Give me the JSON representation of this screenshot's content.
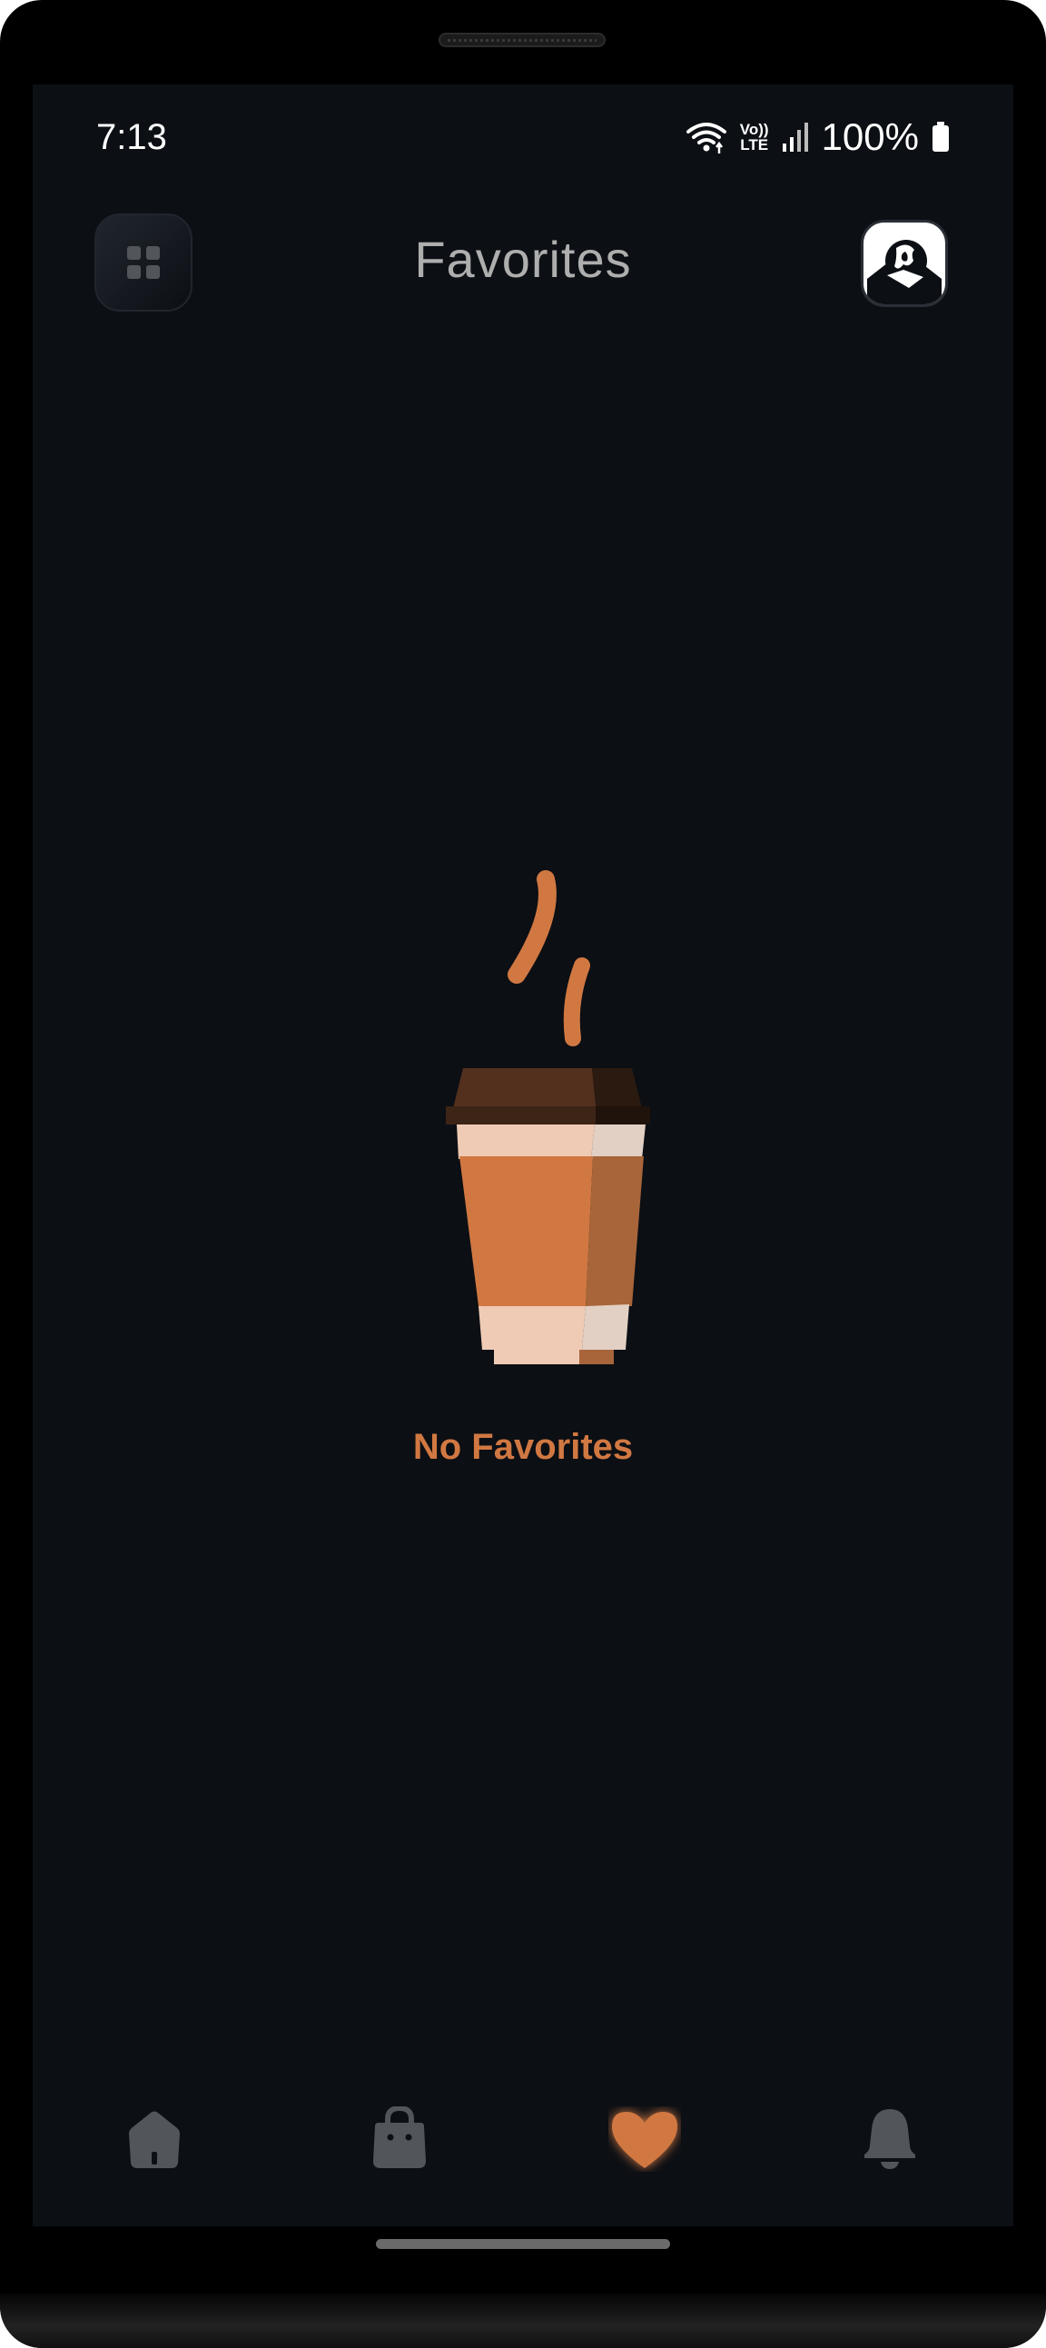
{
  "status_bar": {
    "time": "7:13",
    "network_label_top": "Vo))",
    "network_label_bottom": "LTE",
    "battery": "100%",
    "icons": [
      "wifi-icon",
      "signal-icon",
      "battery-icon"
    ]
  },
  "header": {
    "title": "Favorites",
    "menu_icon": "grid-icon",
    "avatar_icon": "profile-avatar"
  },
  "main": {
    "empty_state_text": "No Favorites",
    "illustration": "coffee-cup-illustration"
  },
  "bottom_nav": {
    "items": [
      {
        "icon": "home-icon",
        "active": false
      },
      {
        "icon": "shopping-bag-icon",
        "active": false
      },
      {
        "icon": "heart-icon",
        "active": true
      },
      {
        "icon": "bell-icon",
        "active": false
      }
    ]
  },
  "colors": {
    "background": "#0c0f14",
    "accent": "#d17842",
    "inactive_icon": "#52555a",
    "title": "#aeaeae"
  }
}
